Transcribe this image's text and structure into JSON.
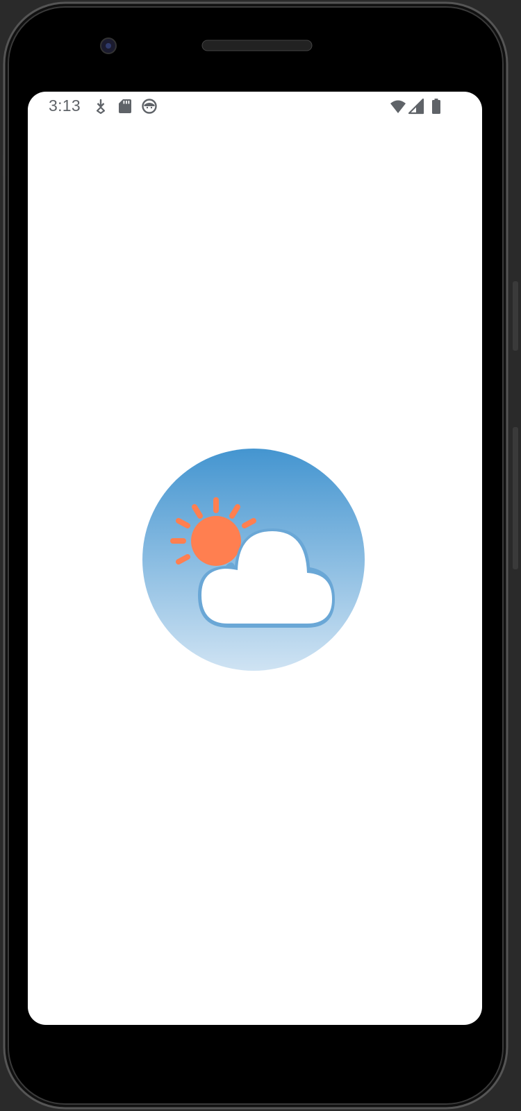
{
  "status_bar": {
    "time": "3:13",
    "left_icons": [
      "download-icon",
      "sd-card-icon",
      "app-face-icon"
    ],
    "right_icons": [
      "wifi-icon",
      "cellular-signal-icon",
      "battery-icon"
    ]
  },
  "splash": {
    "logo": "weather-partly-cloudy-icon",
    "colors": {
      "sky_top": "#4495d0",
      "sky_bottom": "#cfe3f3",
      "sun": "#ff7f50",
      "cloud": "#ffffff"
    }
  },
  "device": {
    "frame_color": "#000000",
    "background": "#2a2a2a",
    "status_icon_color": "#5f6368"
  }
}
